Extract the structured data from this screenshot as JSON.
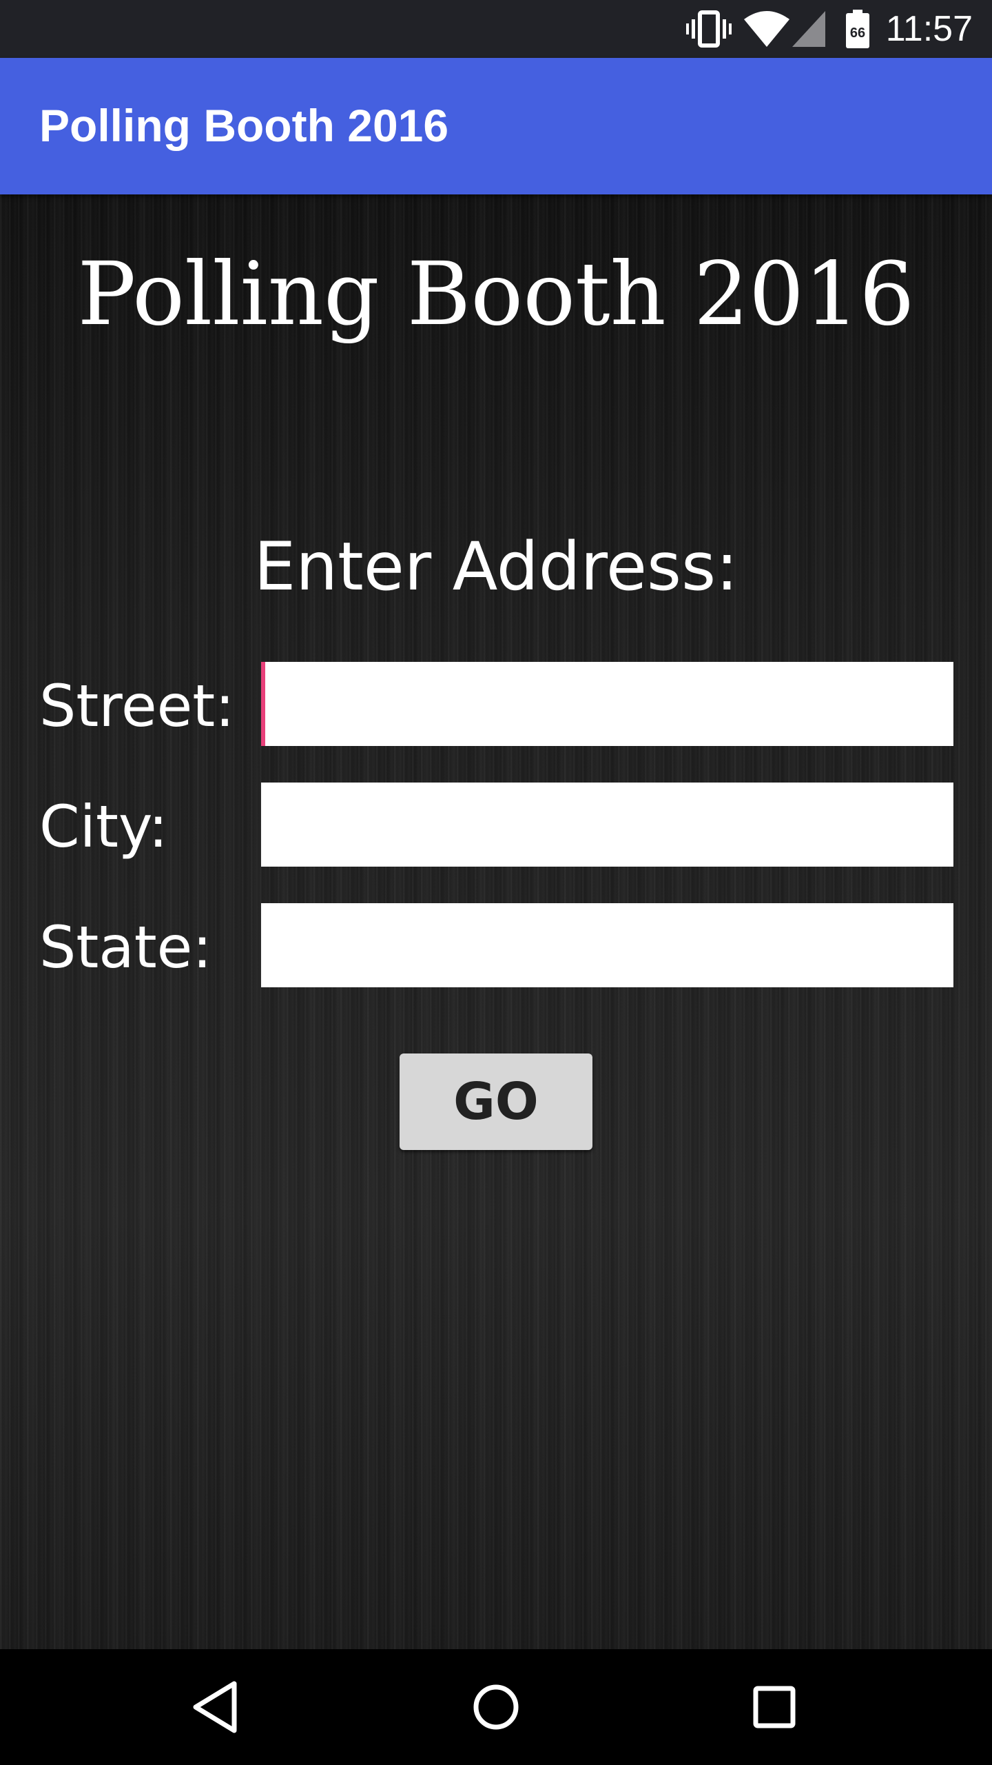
{
  "status_bar": {
    "time": "11:57",
    "icons": [
      "vibrate-icon",
      "wifi-icon",
      "cell-signal-icon",
      "battery-icon"
    ],
    "battery_level": "66"
  },
  "app_bar": {
    "title": "Polling Booth 2016",
    "color": "#4560e0"
  },
  "main": {
    "title": "Polling Booth 2016",
    "section_label": "Enter Address:",
    "fields": [
      {
        "label": "Street:",
        "value": "",
        "focused": true
      },
      {
        "label": "City:",
        "value": ""
      },
      {
        "label": "State:",
        "value": ""
      }
    ],
    "go_label": "GO",
    "cursor_color": "#e8407a"
  },
  "nav_bar": {
    "icons": [
      "back-icon",
      "home-icon",
      "recents-icon"
    ]
  }
}
